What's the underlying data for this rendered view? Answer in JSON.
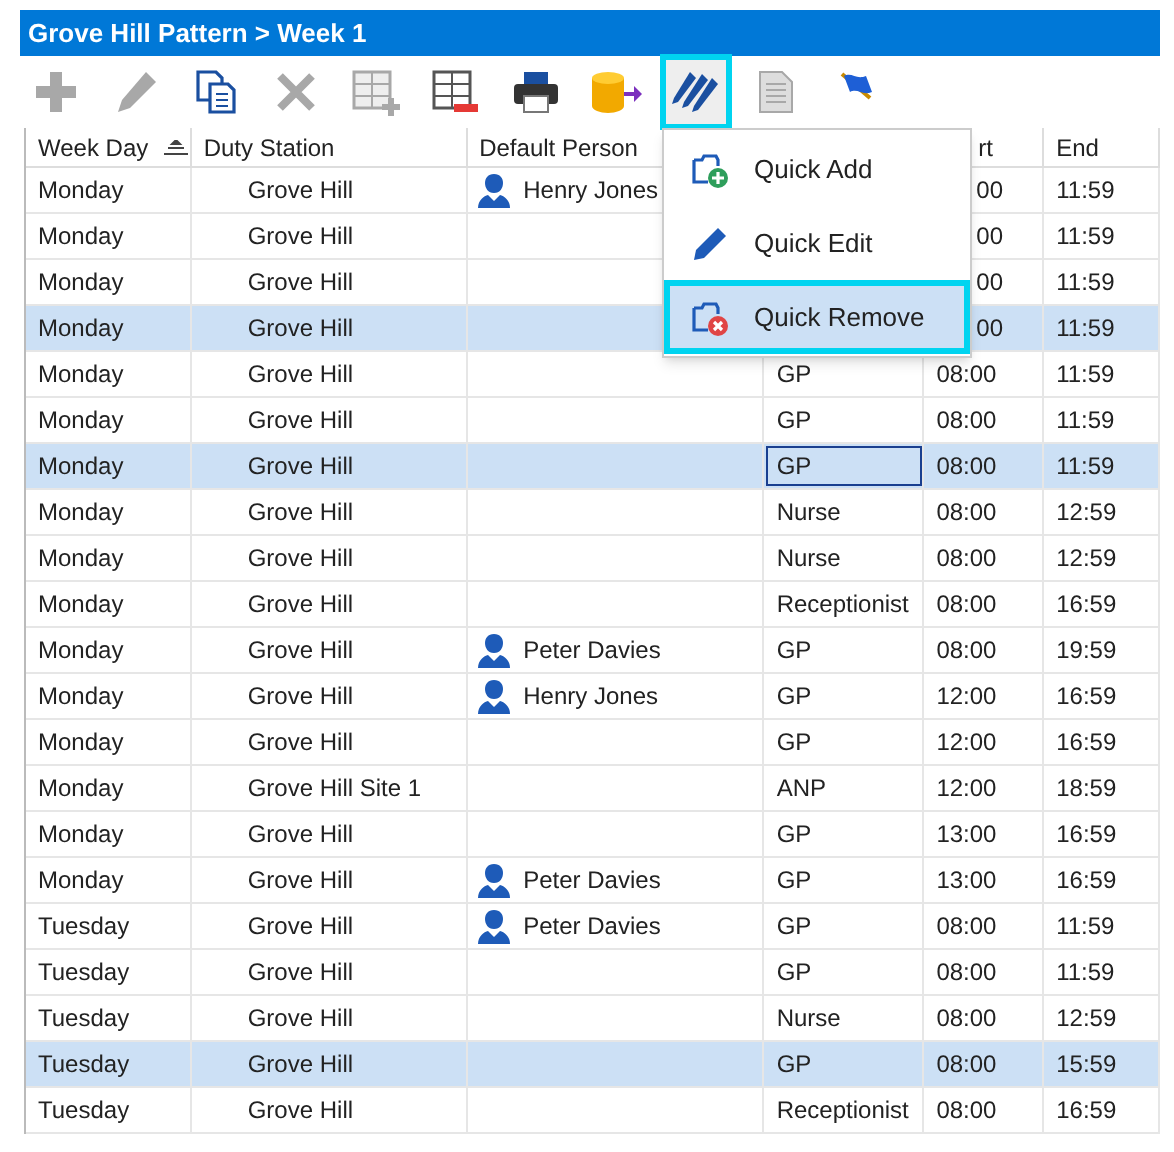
{
  "window": {
    "title": "Grove Hill Pattern > Week 1"
  },
  "toolbar": [
    {
      "kind": "add",
      "disabled": true,
      "highlighted": false
    },
    {
      "kind": "edit",
      "disabled": true,
      "highlighted": false
    },
    {
      "kind": "copy",
      "disabled": false,
      "highlighted": false
    },
    {
      "kind": "delete",
      "disabled": true,
      "highlighted": false
    },
    {
      "kind": "grid-add",
      "disabled": true,
      "highlighted": false
    },
    {
      "kind": "grid-remove",
      "disabled": false,
      "highlighted": false
    },
    {
      "kind": "print",
      "disabled": false,
      "highlighted": false
    },
    {
      "kind": "export",
      "disabled": false,
      "highlighted": false
    },
    {
      "kind": "quick-edit",
      "disabled": false,
      "highlighted": true
    },
    {
      "kind": "document",
      "disabled": true,
      "highlighted": false
    },
    {
      "kind": "flag",
      "disabled": false,
      "highlighted": false
    }
  ],
  "table": {
    "columns": [
      {
        "label": "Week Day",
        "sorted": true
      },
      {
        "label": "Duty Station",
        "sorted": false
      },
      {
        "label": "Default Person",
        "sorted": false
      },
      {
        "label": "rt",
        "sorted": false
      },
      {
        "label": "End",
        "sorted": false
      }
    ],
    "rows": [
      {
        "day": "Monday",
        "station": "Grove Hill",
        "person": "Henry Jones",
        "role": "",
        "start": "00",
        "end": "11:59",
        "covered": true,
        "selected": false,
        "focused": false
      },
      {
        "day": "Monday",
        "station": "Grove Hill",
        "person": "",
        "role": "",
        "start": "00",
        "end": "11:59",
        "covered": true,
        "selected": false,
        "focused": false
      },
      {
        "day": "Monday",
        "station": "Grove Hill",
        "person": "",
        "role": "",
        "start": "00",
        "end": "11:59",
        "covered": true,
        "selected": false,
        "focused": false
      },
      {
        "day": "Monday",
        "station": "Grove Hill",
        "person": "",
        "role": "",
        "start": "00",
        "end": "11:59",
        "covered": true,
        "selected": true,
        "focused": false
      },
      {
        "day": "Monday",
        "station": "Grove Hill",
        "person": "",
        "role": "GP",
        "start": "08:00",
        "end": "11:59",
        "covered": false,
        "selected": false,
        "focused": false
      },
      {
        "day": "Monday",
        "station": "Grove Hill",
        "person": "",
        "role": "GP",
        "start": "08:00",
        "end": "11:59",
        "covered": false,
        "selected": false,
        "focused": false
      },
      {
        "day": "Monday",
        "station": "Grove Hill",
        "person": "",
        "role": "GP",
        "start": "08:00",
        "end": "11:59",
        "covered": false,
        "selected": true,
        "focused": true
      },
      {
        "day": "Monday",
        "station": "Grove Hill",
        "person": "",
        "role": "Nurse",
        "start": "08:00",
        "end": "12:59",
        "covered": false,
        "selected": false,
        "focused": false
      },
      {
        "day": "Monday",
        "station": "Grove Hill",
        "person": "",
        "role": "Nurse",
        "start": "08:00",
        "end": "12:59",
        "covered": false,
        "selected": false,
        "focused": false
      },
      {
        "day": "Monday",
        "station": "Grove Hill",
        "person": "",
        "role": "Receptionist",
        "start": "08:00",
        "end": "16:59",
        "covered": false,
        "selected": false,
        "focused": false
      },
      {
        "day": "Monday",
        "station": "Grove Hill",
        "person": "Peter Davies",
        "role": "GP",
        "start": "08:00",
        "end": "19:59",
        "covered": false,
        "selected": false,
        "focused": false
      },
      {
        "day": "Monday",
        "station": "Grove Hill",
        "person": "Henry Jones",
        "role": "GP",
        "start": "12:00",
        "end": "16:59",
        "covered": false,
        "selected": false,
        "focused": false
      },
      {
        "day": "Monday",
        "station": "Grove Hill",
        "person": "",
        "role": "GP",
        "start": "12:00",
        "end": "16:59",
        "covered": false,
        "selected": false,
        "focused": false
      },
      {
        "day": "Monday",
        "station": "Grove Hill Site 1",
        "person": "",
        "role": "ANP",
        "start": "12:00",
        "end": "18:59",
        "covered": false,
        "selected": false,
        "focused": false
      },
      {
        "day": "Monday",
        "station": "Grove Hill",
        "person": "",
        "role": "GP",
        "start": "13:00",
        "end": "16:59",
        "covered": false,
        "selected": false,
        "focused": false
      },
      {
        "day": "Monday",
        "station": "Grove Hill",
        "person": "Peter Davies",
        "role": "GP",
        "start": "13:00",
        "end": "16:59",
        "covered": false,
        "selected": false,
        "focused": false
      },
      {
        "day": "Tuesday",
        "station": "Grove Hill",
        "person": "Peter Davies",
        "role": "GP",
        "start": "08:00",
        "end": "11:59",
        "covered": false,
        "selected": false,
        "focused": false
      },
      {
        "day": "Tuesday",
        "station": "Grove Hill",
        "person": "",
        "role": "GP",
        "start": "08:00",
        "end": "11:59",
        "covered": false,
        "selected": false,
        "focused": false
      },
      {
        "day": "Tuesday",
        "station": "Grove Hill",
        "person": "",
        "role": "Nurse",
        "start": "08:00",
        "end": "12:59",
        "covered": false,
        "selected": false,
        "focused": false
      },
      {
        "day": "Tuesday",
        "station": "Grove Hill",
        "person": "",
        "role": "GP",
        "start": "08:00",
        "end": "15:59",
        "covered": false,
        "selected": true,
        "focused": false
      },
      {
        "day": "Tuesday",
        "station": "Grove Hill",
        "person": "",
        "role": "Receptionist",
        "start": "08:00",
        "end": "16:59",
        "covered": false,
        "selected": false,
        "focused": false
      }
    ]
  },
  "menu": [
    {
      "kind": "add",
      "label": "Quick Add",
      "selected": false
    },
    {
      "kind": "edit",
      "label": "Quick Edit",
      "selected": false
    },
    {
      "kind": "remove",
      "label": "Quick Remove",
      "selected": true
    }
  ]
}
